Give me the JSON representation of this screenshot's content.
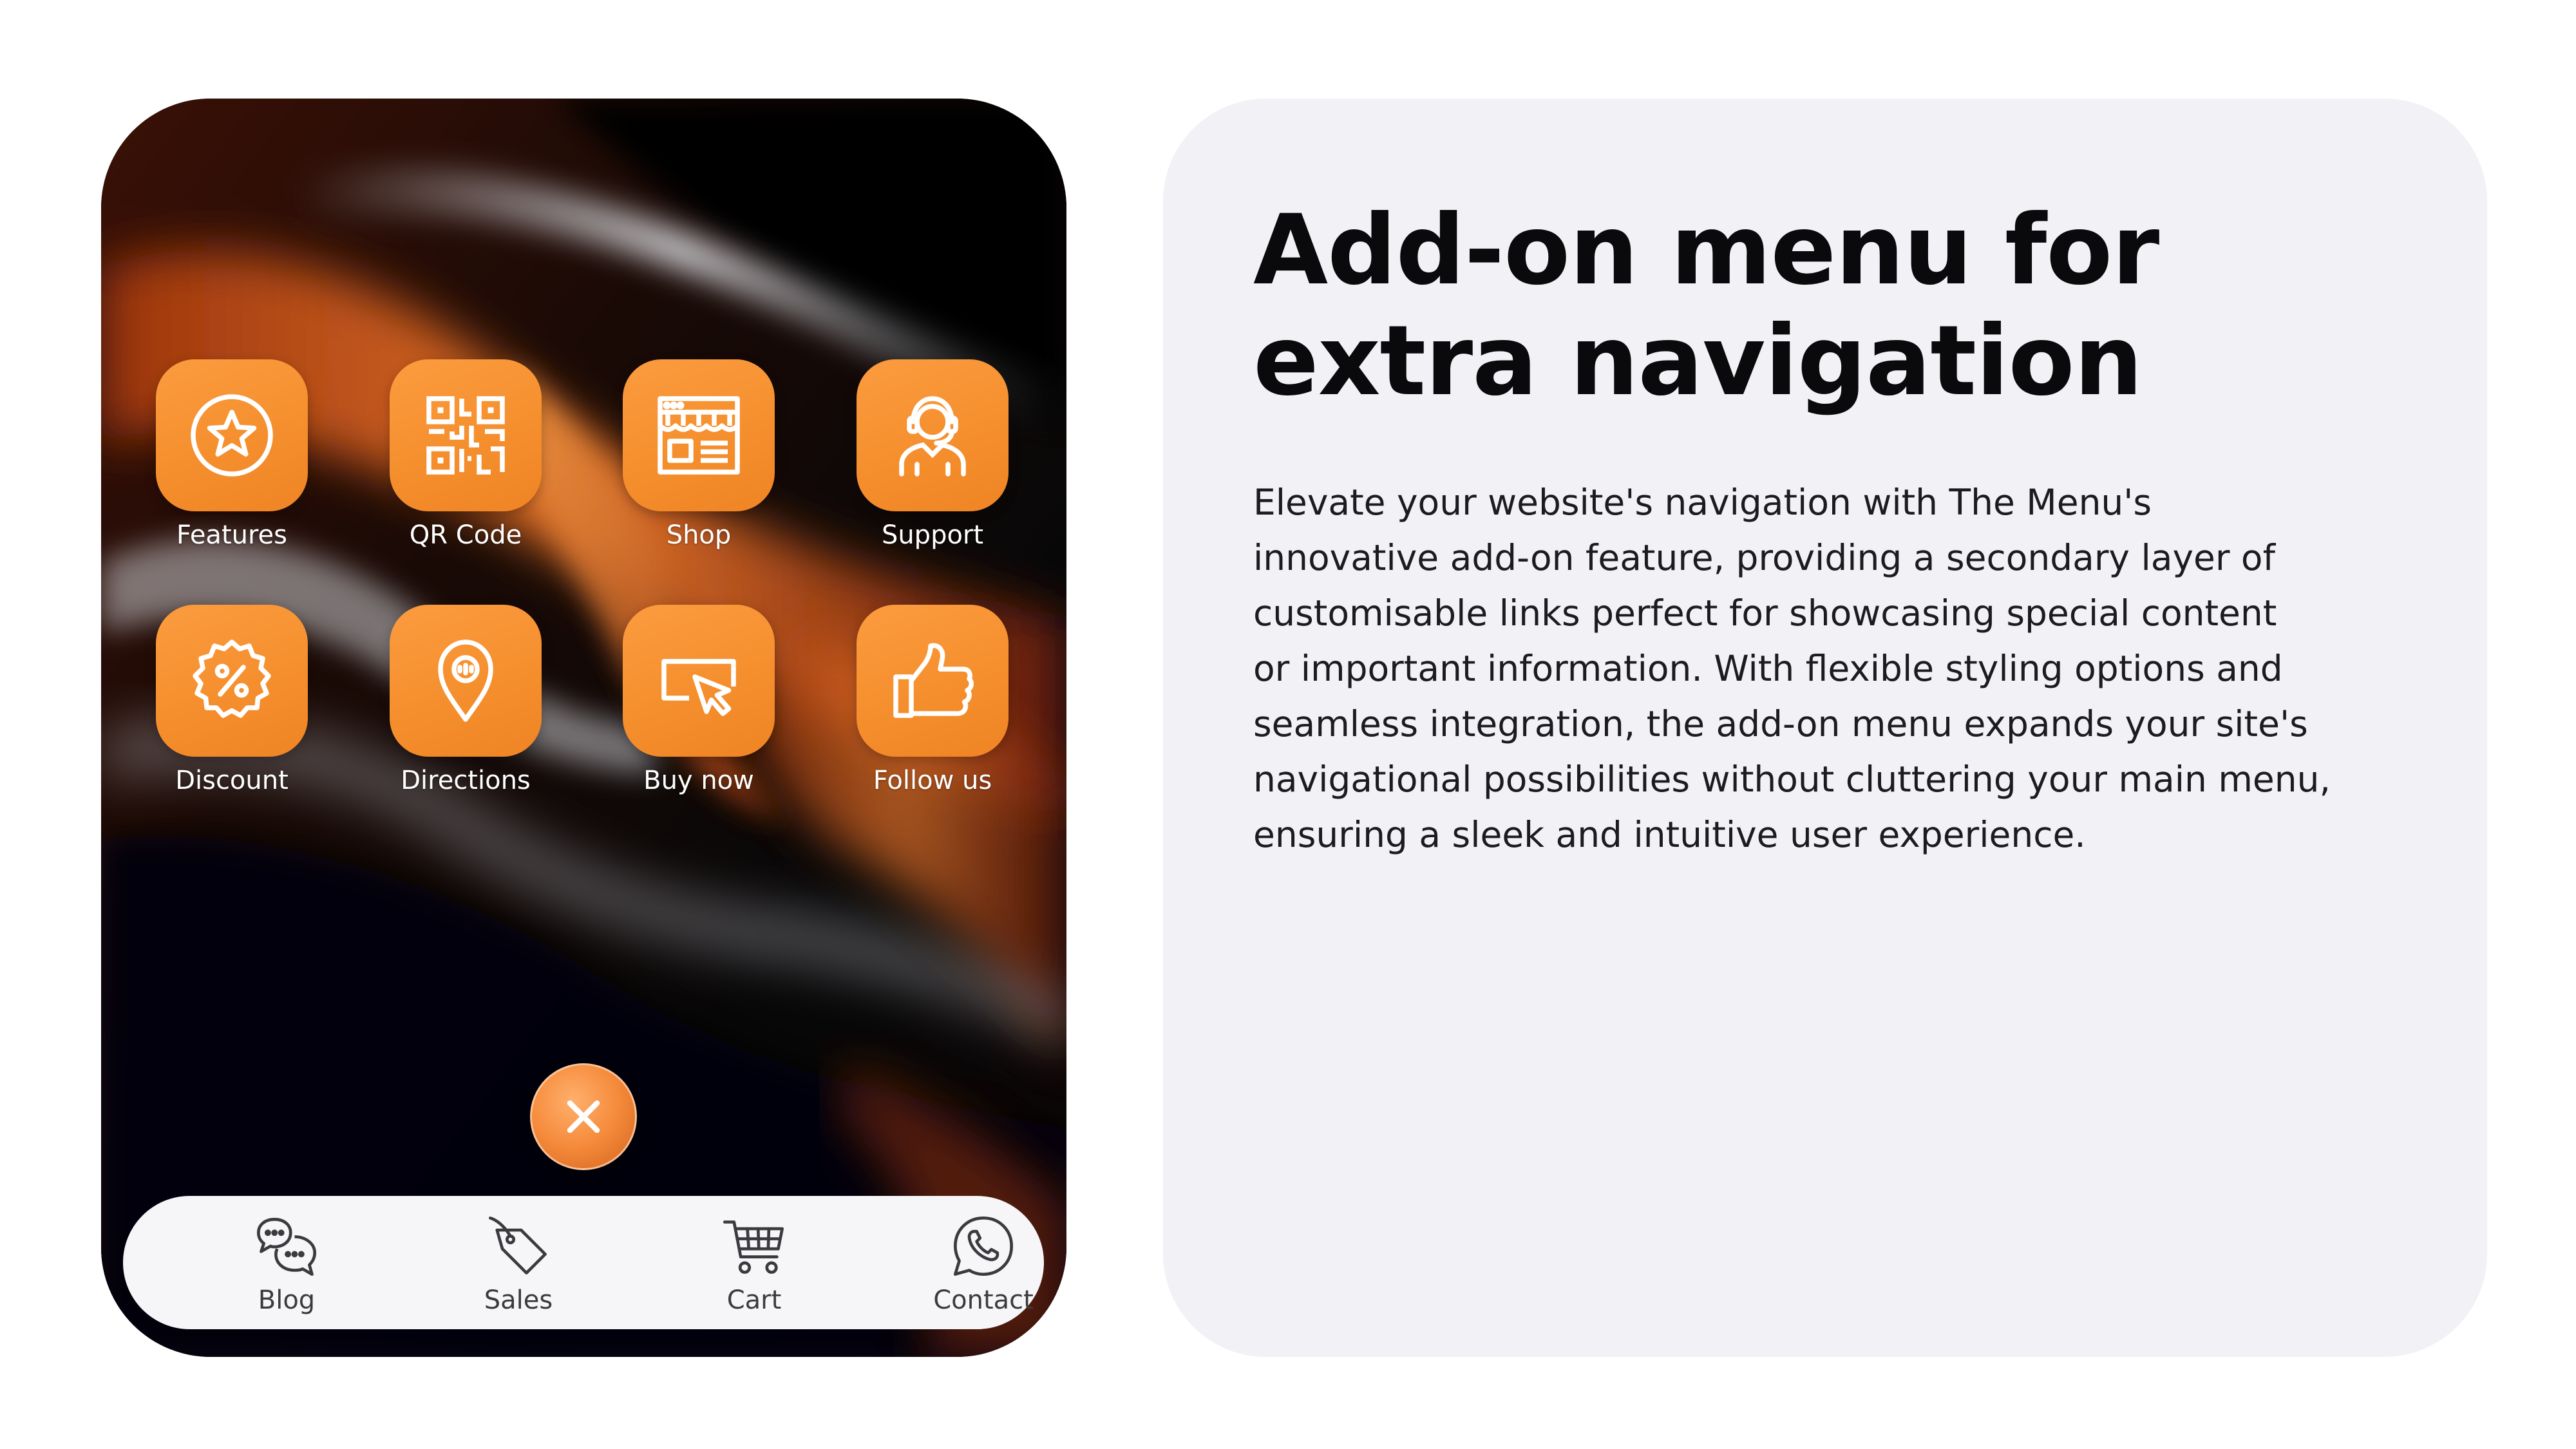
{
  "colors": {
    "accent_orange": "#f5922f",
    "card_background": "#f1f1f6",
    "bottom_bar_background": "#f6f6f8",
    "headline_text": "#0a0a0c",
    "body_text": "#1c1c20"
  },
  "menu": {
    "items": [
      {
        "label": "Features",
        "icon": "star-circle-icon"
      },
      {
        "label": "QR Code",
        "icon": "qr-code-icon"
      },
      {
        "label": "Shop",
        "icon": "storefront-icon"
      },
      {
        "label": "Support",
        "icon": "headset-support-icon"
      },
      {
        "label": "Discount",
        "icon": "discount-badge-icon"
      },
      {
        "label": "Directions",
        "icon": "map-pin-icon"
      },
      {
        "label": "Buy now",
        "icon": "cursor-click-icon"
      },
      {
        "label": "Follow us",
        "icon": "thumbs-up-icon"
      }
    ],
    "close_icon": "close-icon"
  },
  "bottom_nav": {
    "items": [
      {
        "label": "Blog",
        "icon": "chat-bubbles-icon"
      },
      {
        "label": "Sales",
        "icon": "price-tag-icon"
      },
      {
        "label": "Cart",
        "icon": "shopping-cart-icon"
      },
      {
        "label": "Contact",
        "icon": "whatsapp-phone-icon"
      }
    ]
  },
  "info": {
    "headline_lines": [
      "Add-on menu for",
      "extra navigation"
    ],
    "body_lines": [
      "Elevate your website's navigation with The Menu's",
      "innovative add-on feature, providing a secondary layer of",
      "customisable links perfect for showcasing special content",
      "or important information. With flexible styling options and",
      "seamless integration, the add-on menu expands your site's",
      "navigational possibilities without cluttering your main menu,",
      "ensuring a sleek and intuitive user experience."
    ]
  }
}
